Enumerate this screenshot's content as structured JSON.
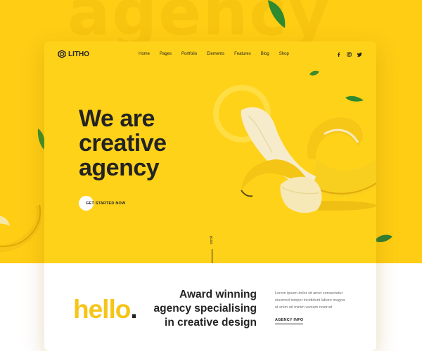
{
  "background_word": "agency",
  "brand": {
    "name": "LITHO"
  },
  "nav": {
    "items": [
      {
        "label": "Home"
      },
      {
        "label": "Pages"
      },
      {
        "label": "Portfolio"
      },
      {
        "label": "Elements"
      },
      {
        "label": "Features"
      },
      {
        "label": "Blog"
      },
      {
        "label": "Shop"
      }
    ]
  },
  "social": {
    "icons": [
      "facebook-icon",
      "instagram-icon",
      "twitter-icon"
    ]
  },
  "hero": {
    "title_lines": [
      "We are",
      "creative",
      "agency"
    ],
    "cta_label": "GET STARTED NOW",
    "scroll_label": "scroll"
  },
  "intro": {
    "hello": "hello",
    "hello_dot": ".",
    "award_lines": [
      "Award winning",
      "agency specialising",
      "in creative design"
    ],
    "description_lines": [
      "Lorem ipsum dolor sit amet consectetur",
      "eiusmod tempor incididunt labore magna",
      "ut enim ad minim veniam nostrud"
    ],
    "link_label": "AGENCY INFO"
  },
  "colors": {
    "accent": "#fecd14",
    "text": "#232323"
  }
}
